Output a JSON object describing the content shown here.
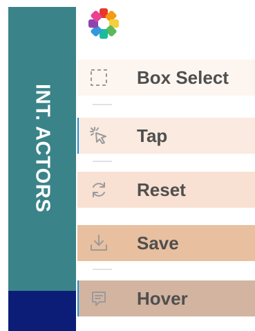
{
  "sidebar": {
    "title": "INT. ACTORS"
  },
  "tools": [
    {
      "label": "Box Select",
      "icon": "box-select-icon",
      "bg": "#fdf5f0",
      "active": false
    },
    {
      "label": "Tap",
      "icon": "tap-icon",
      "bg": "#fbeadf",
      "active": true
    },
    {
      "label": "Reset",
      "icon": "reset-icon",
      "bg": "#f8e0d2",
      "active": false
    },
    {
      "label": "Save",
      "icon": "save-icon",
      "bg": "#e8bf9f",
      "active": false
    },
    {
      "label": "Hover",
      "icon": "hover-icon",
      "bg": "#d2b4a0",
      "active": true
    }
  ],
  "colors": {
    "sidebar_teal": "#3a8489",
    "sidebar_navy": "#0c1d78",
    "accent_blue": "#1f8fd6",
    "label_text": "#4f4f4f",
    "icon_gray": "#9a9a9a"
  }
}
